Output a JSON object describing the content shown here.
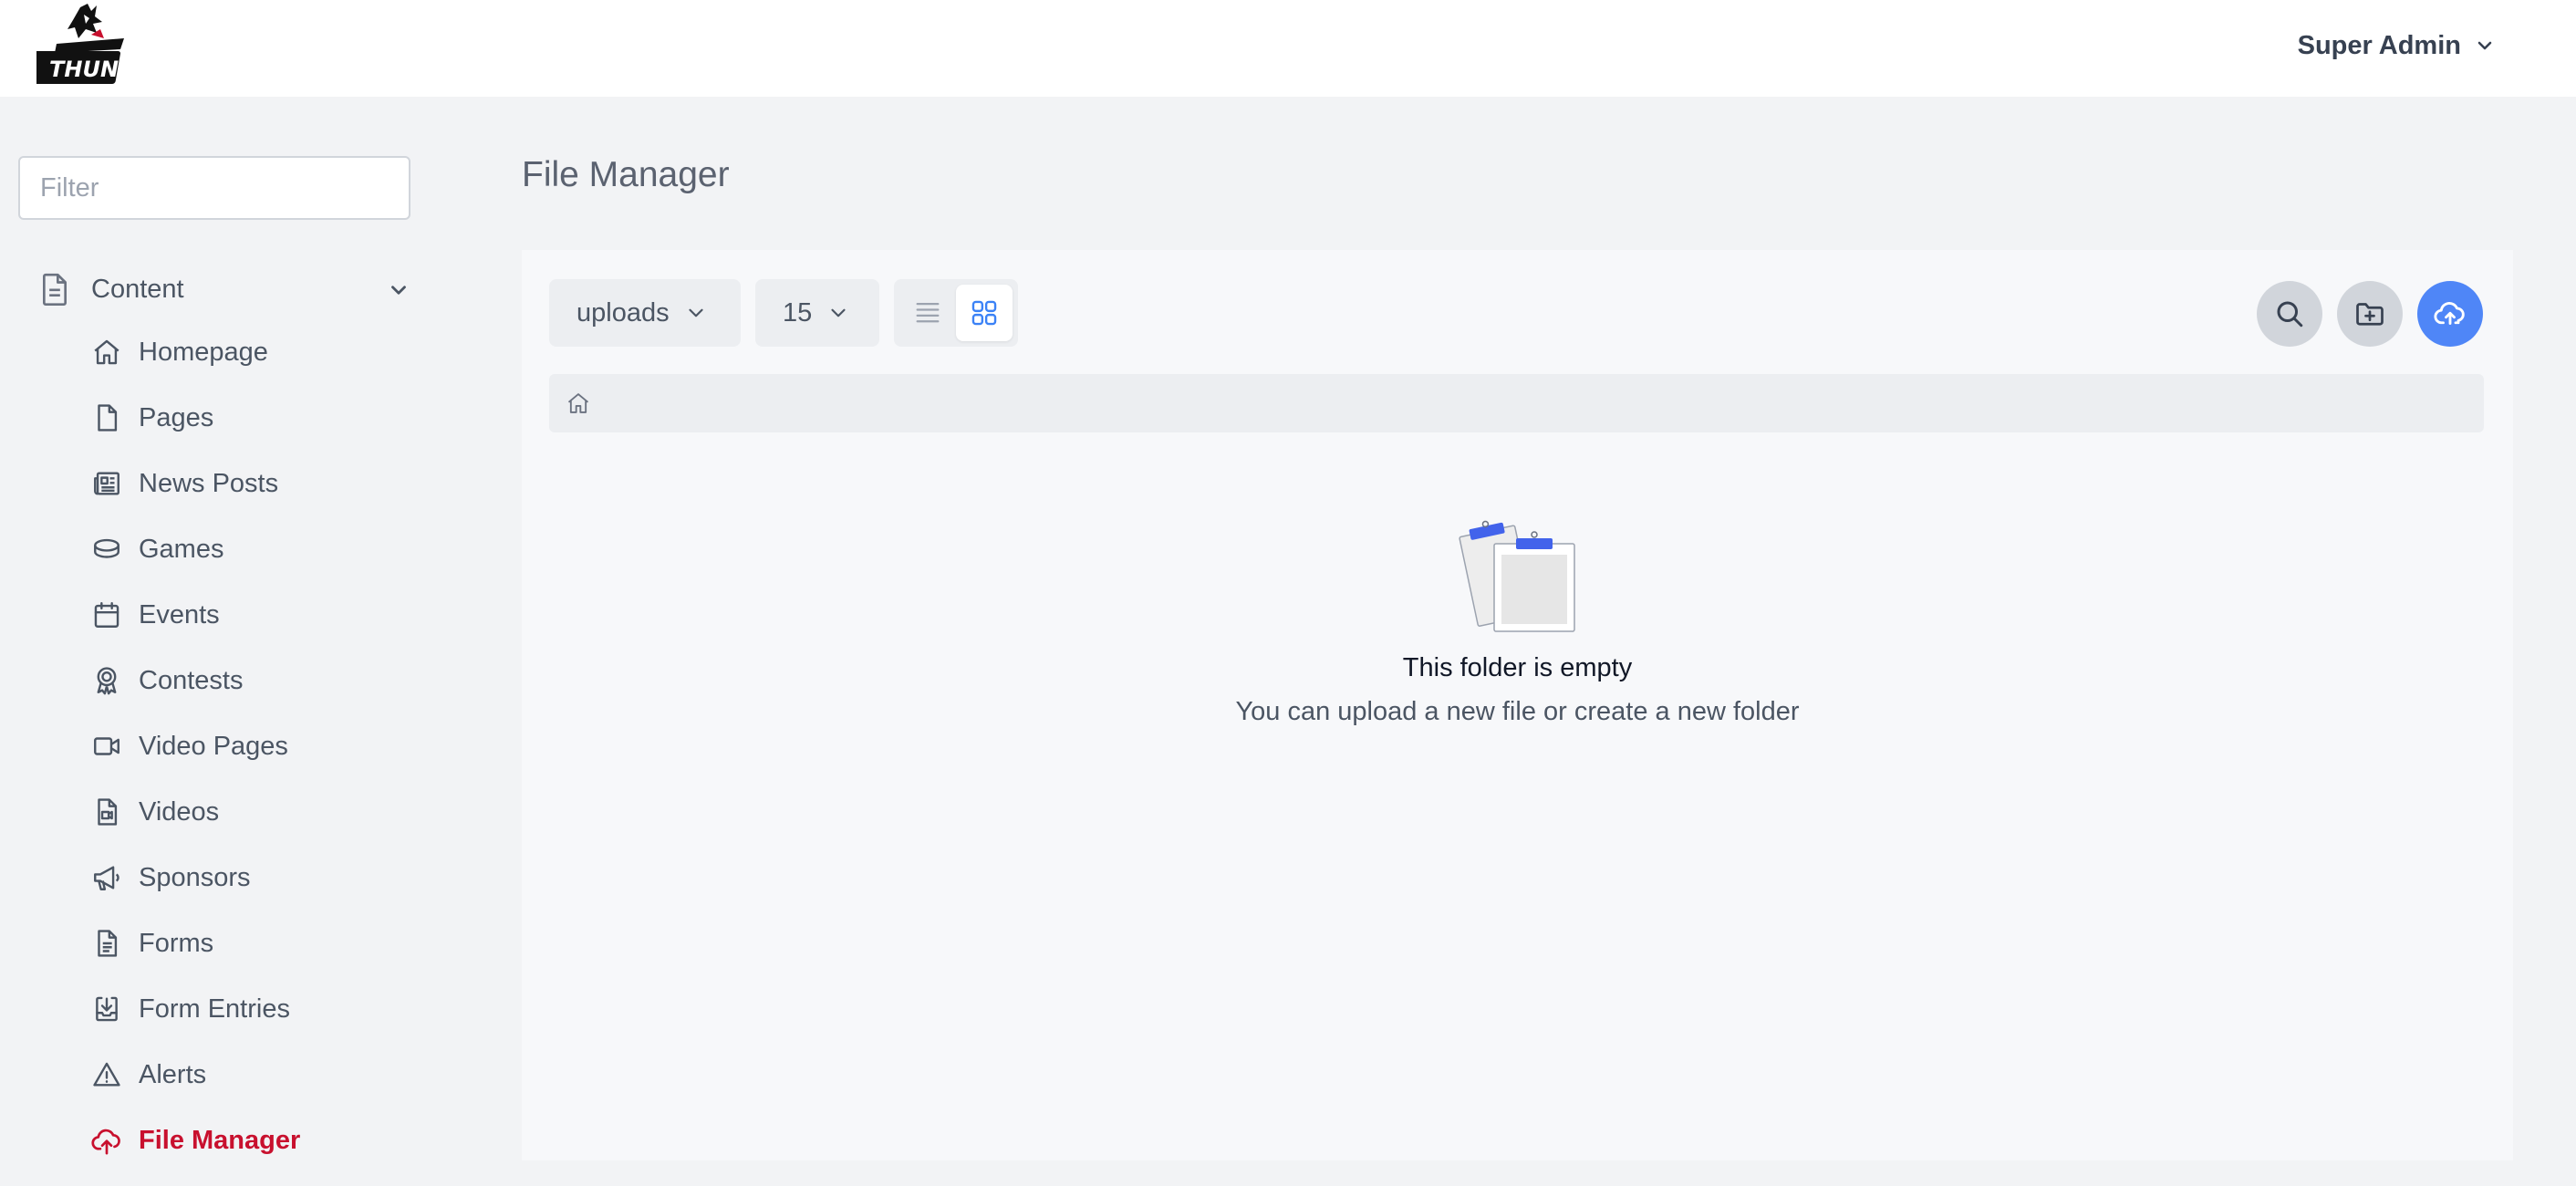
{
  "header": {
    "logo_alt": "Thunder",
    "user_name": "Super Admin"
  },
  "sidebar": {
    "filter_placeholder": "Filter",
    "group": {
      "label": "Content",
      "icon": "document-icon"
    },
    "items": [
      {
        "label": "Homepage",
        "icon": "home-icon"
      },
      {
        "label": "Pages",
        "icon": "page-icon"
      },
      {
        "label": "News Posts",
        "icon": "newspaper-icon"
      },
      {
        "label": "Games",
        "icon": "puck-icon"
      },
      {
        "label": "Events",
        "icon": "calendar-icon"
      },
      {
        "label": "Contests",
        "icon": "award-icon"
      },
      {
        "label": "Video Pages",
        "icon": "video-camera-icon"
      },
      {
        "label": "Videos",
        "icon": "video-file-icon"
      },
      {
        "label": "Sponsors",
        "icon": "megaphone-icon"
      },
      {
        "label": "Forms",
        "icon": "form-icon"
      },
      {
        "label": "Form Entries",
        "icon": "inbox-download-icon"
      },
      {
        "label": "Alerts",
        "icon": "warning-icon"
      },
      {
        "label": "File Manager",
        "icon": "cloud-upload-icon",
        "active": true
      }
    ]
  },
  "main": {
    "title": "File Manager",
    "toolbar": {
      "folder_select": "uploads",
      "per_page_select": "15",
      "view_mode": "grid"
    },
    "empty_state": {
      "title": "This folder is empty",
      "subtitle": "You can upload a new file or create a new folder"
    }
  },
  "colors": {
    "accent_blue": "#4f86f7",
    "active_red": "#c8102e",
    "page_bg": "#f2f3f5"
  }
}
